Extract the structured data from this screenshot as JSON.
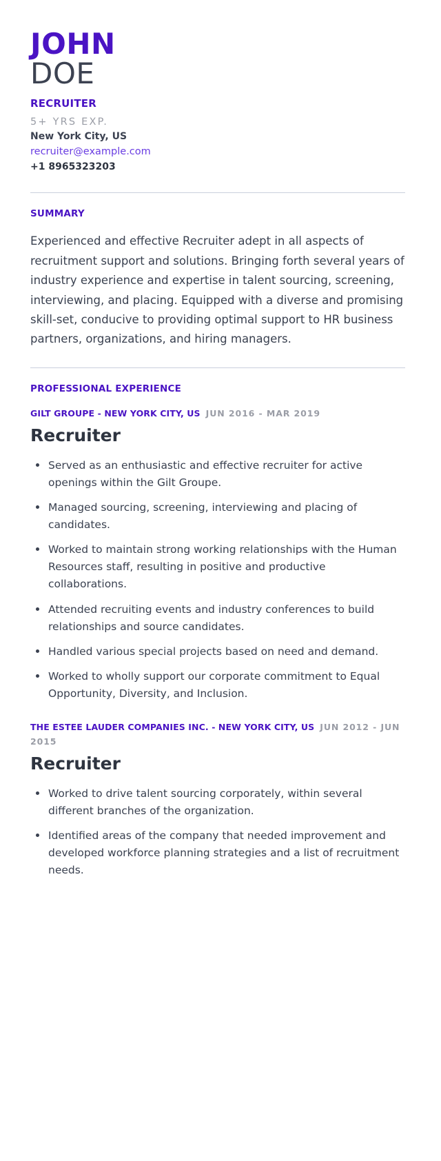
{
  "header": {
    "first_name": "JOHN",
    "last_name": "DOE",
    "role": "RECRUITER",
    "experience": "5+ YRS EXP.",
    "location": "New York City, US",
    "email": "recruiter@example.com",
    "phone": "+1 8965323203"
  },
  "colors": {
    "accent": "#4a13c4",
    "link": "#6a3de2",
    "text": "#3a4150",
    "muted": "#9a9da6",
    "divider": "#c9cfdd"
  },
  "sections": {
    "summary": {
      "title": "SUMMARY",
      "text": "Experienced and effective Recruiter adept in all aspects of recruitment support and solutions. Bringing forth several years of industry experience and expertise in talent sourcing, screening, interviewing, and placing. Equipped with a diverse and promising skill-set, conducive to providing optimal support to HR business partners, organizations, and hiring managers."
    },
    "experience": {
      "title": "PROFESSIONAL EXPERIENCE",
      "jobs": [
        {
          "company": "GILT GROUPE - NEW YORK CITY, US",
          "dates": "JUN 2016 - MAR 2019",
          "title": "Recruiter",
          "bullets": [
            "Served as an enthusiastic and effective recruiter for active openings within the Gilt Groupe.",
            "Managed sourcing, screening, interviewing and placing of candidates.",
            "Worked to maintain strong working relationships with the Human Resources staff, resulting in positive and productive collaborations.",
            "Attended recruiting events and industry conferences to build relationships and source candidates.",
            "Handled various special projects based on need and demand.",
            "Worked to wholly support our corporate commitment to Equal Opportunity, Diversity, and Inclusion."
          ]
        },
        {
          "company": "THE ESTEE LAUDER COMPANIES INC. - NEW YORK CITY, US",
          "dates": "JUN 2012 - JUN 2015",
          "title": "Recruiter",
          "bullets": [
            "Worked to drive talent sourcing corporately, within several different branches of the organization.",
            "Identified areas of the company that needed improvement and developed workforce planning strategies and a list of recruitment needs."
          ]
        }
      ]
    }
  }
}
